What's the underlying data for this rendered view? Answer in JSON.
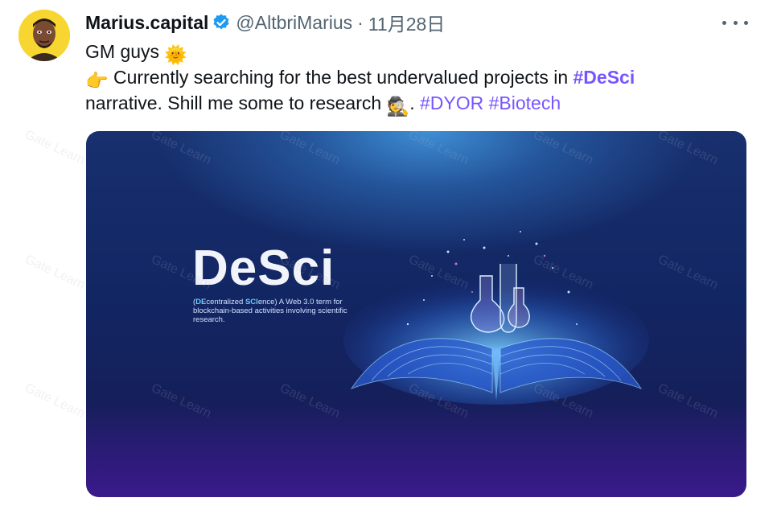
{
  "tweet": {
    "author": {
      "display_name": "Marius.capital",
      "handle": "@AltbriMarius",
      "verified_icon": "verified-badge-icon",
      "avatar_icon": "avatar-cartoon-face"
    },
    "separator": "·",
    "date": "11月28日",
    "more_icon": "more-options-icon",
    "line1_text": "GM guys",
    "line1_emoji": "🌞",
    "line2_emoji": "👉",
    "line2_text": "Currently searching for the best undervalued projects in",
    "hashtag_desci": "#DeSci",
    "line3_text": "narrative. Shill me some to research",
    "line3_emoji": "🕵️",
    "line3_period": ".",
    "hashtag_dyor": "#DYOR",
    "hashtag_biotech": "#Biotech"
  },
  "media": {
    "title": "DeSci",
    "subtitle_prefix_a": "(",
    "subtitle_hl_a": "DE",
    "subtitle_mid_a": "centralized ",
    "subtitle_hl_b": "SCI",
    "subtitle_rest": "ence) A Web 3.0 term for blockchain-based activities involving scientific research.",
    "art_icon": "open-book-with-flasks-illustration"
  },
  "watermark": "Gate Learn",
  "colors": {
    "hashtag": "#7856ff",
    "verified": "#1d9bf0",
    "avatar_bg": "#f7d631",
    "secondary_text": "#536471"
  }
}
